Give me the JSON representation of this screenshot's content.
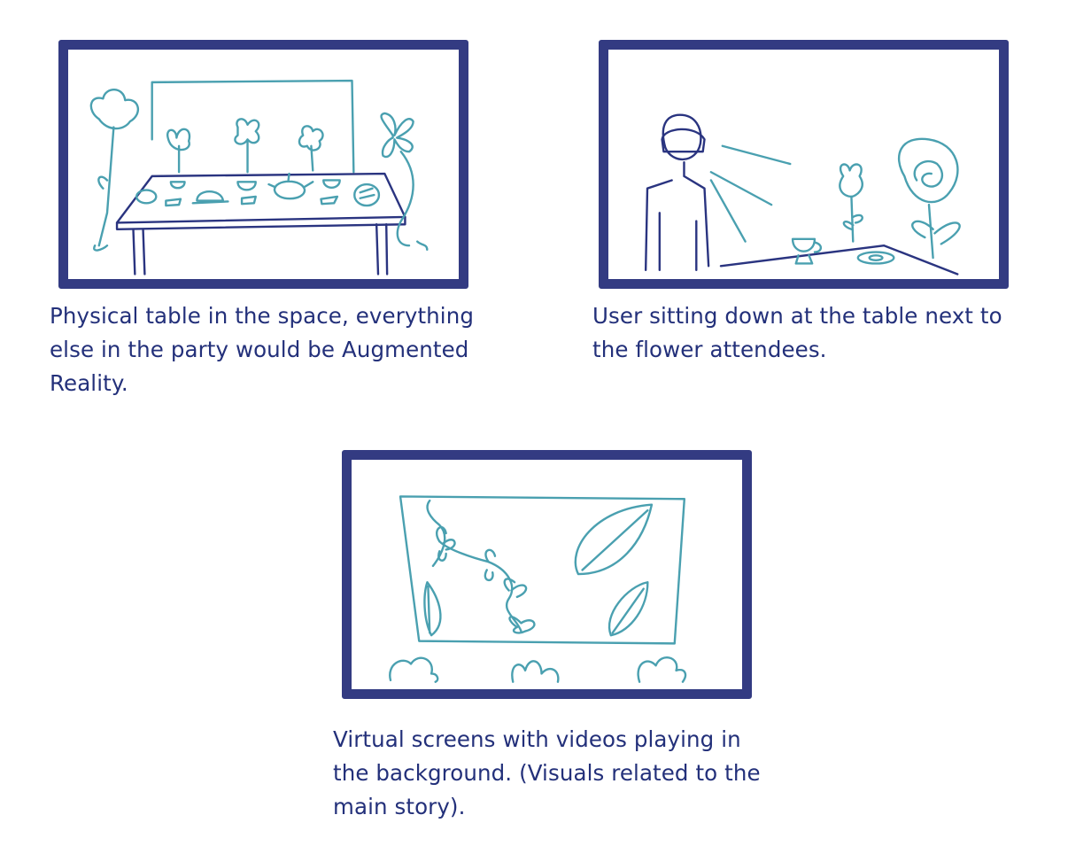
{
  "storyboard": {
    "panels": [
      {
        "caption": "Physical table in the space, everything else in the party would be Augmented Reality.",
        "scene": "physical-table-sketch"
      },
      {
        "caption": "User sitting down at the table next to the flower attendees.",
        "scene": "user-at-table-sketch"
      },
      {
        "caption": "Virtual screens with videos playing in the background. (Visuals related to the main story).",
        "scene": "virtual-screens-sketch"
      }
    ]
  },
  "colors": {
    "frame": "#333b82",
    "sketch_teal": "#4aa0b0",
    "sketch_navy": "#2a3480",
    "caption": "#23307a"
  }
}
